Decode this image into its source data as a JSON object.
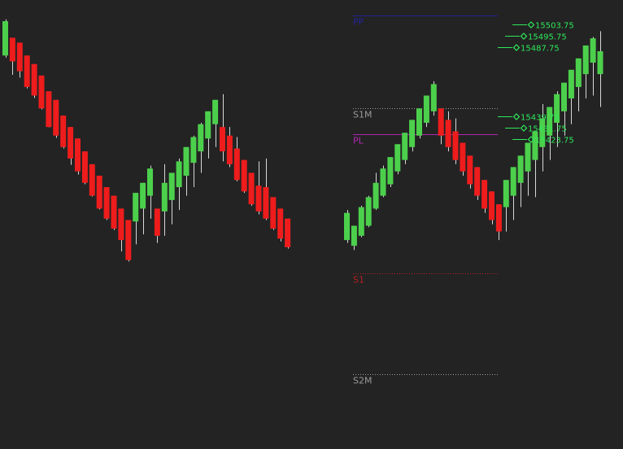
{
  "chart_data": {
    "type": "candlestick",
    "y_mapping": {
      "price_at_top": 15510,
      "price_per_px": 0.5686
    },
    "candles_first_side": [
      {
        "o": 15482.0,
        "c": 15506.0,
        "l": 15480.5,
        "h": 15507.3
      },
      {
        "o": 15494.4,
        "c": 15477.9,
        "l": 15468.5,
        "h": 15494.4
      },
      {
        "o": 15491.0,
        "c": 15471.0,
        "l": 15466.5,
        "h": 15491.0
      },
      {
        "o": 15482.0,
        "c": 15460.0,
        "l": 15459.0,
        "h": 15482.0
      },
      {
        "o": 15476.0,
        "c": 15454.0,
        "l": 15452.3,
        "h": 15476.0
      },
      {
        "o": 15468.0,
        "c": 15445.0,
        "l": 15444.3,
        "h": 15468.0
      },
      {
        "o": 15457.0,
        "c": 15432.0,
        "l": 15431.8,
        "h": 15457.0
      },
      {
        "o": 15451.0,
        "c": 15426.0,
        "l": 15424.4,
        "h": 15451.0
      },
      {
        "o": 15440.0,
        "c": 15418.0,
        "l": 15417.0,
        "h": 15440.0
      },
      {
        "o": 15432.0,
        "c": 15410.0,
        "l": 15405.6,
        "h": 15432.0
      },
      {
        "o": 15424.0,
        "c": 15401.0,
        "l": 15398.8,
        "h": 15424.0
      },
      {
        "o": 15415.0,
        "c": 15393.0,
        "l": 15392.0,
        "h": 15415.0
      },
      {
        "o": 15406.0,
        "c": 15384.0,
        "l": 15383.5,
        "h": 15406.0
      },
      {
        "o": 15398.0,
        "c": 15375.0,
        "l": 15374.4,
        "h": 15398.0
      },
      {
        "o": 15390.0,
        "c": 15368.0,
        "l": 15367.0,
        "h": 15390.0
      },
      {
        "o": 15384.0,
        "c": 15361.0,
        "l": 15360.0,
        "h": 15384.0
      },
      {
        "o": 15375.0,
        "c": 15353.0,
        "l": 15345.0,
        "h": 15375.0
      },
      {
        "o": 15367.0,
        "c": 15339.0,
        "l": 15338.0,
        "h": 15367.0
      },
      {
        "o": 15366.0,
        "c": 15386.0,
        "l": 15350.0,
        "h": 15386.0
      },
      {
        "o": 15375.0,
        "c": 15393.0,
        "l": 15357.0,
        "h": 15393.0
      },
      {
        "o": 15384.0,
        "c": 15403.0,
        "l": 15368.0,
        "h": 15405.0
      },
      {
        "o": 15375.0,
        "c": 15356.0,
        "l": 15351.0,
        "h": 15375.0
      },
      {
        "o": 15373.0,
        "c": 15393.0,
        "l": 15356.0,
        "h": 15406.0
      },
      {
        "o": 15381.0,
        "c": 15400.0,
        "l": 15364.0,
        "h": 15400.0
      },
      {
        "o": 15390.0,
        "c": 15408.0,
        "l": 15374.0,
        "h": 15410.0
      },
      {
        "o": 15398.0,
        "c": 15418.0,
        "l": 15384.0,
        "h": 15418.0
      },
      {
        "o": 15407.0,
        "c": 15425.0,
        "l": 15390.0,
        "h": 15426.0
      },
      {
        "o": 15415.0,
        "c": 15434.0,
        "l": 15400.0,
        "h": 15435.0
      },
      {
        "o": 15424.0,
        "c": 15443.0,
        "l": 15410.0,
        "h": 15443.0
      },
      {
        "o": 15434.0,
        "c": 15451.0,
        "l": 15418.0,
        "h": 15451.0
      },
      {
        "o": 15432.0,
        "c": 15415.0,
        "l": 15408.0,
        "h": 15455.0
      },
      {
        "o": 15426.0,
        "c": 15406.0,
        "l": 15404.0,
        "h": 15432.0
      },
      {
        "o": 15417.0,
        "c": 15395.0,
        "l": 15394.0,
        "h": 15425.0
      },
      {
        "o": 15409.0,
        "c": 15387.0,
        "l": 15386.0,
        "h": 15409.0
      },
      {
        "o": 15400.0,
        "c": 15378.0,
        "l": 15377.0,
        "h": 15400.0
      },
      {
        "o": 15391.0,
        "c": 15373.0,
        "l": 15371.0,
        "h": 15408.0
      },
      {
        "o": 15390.0,
        "c": 15368.0,
        "l": 15367.0,
        "h": 15410.0
      },
      {
        "o": 15383.0,
        "c": 15361.0,
        "l": 15360.0,
        "h": 15383.0
      },
      {
        "o": 15375.0,
        "c": 15354.0,
        "l": 15352.0,
        "h": 15375.0
      },
      {
        "o": 15368.0,
        "c": 15348.0,
        "l": 15347.0,
        "h": 15368.0
      }
    ],
    "candles_second_side": [
      {
        "o": 15353.0,
        "c": 15372.0,
        "l": 15351.0,
        "h": 15374.0
      },
      {
        "o": 15349.0,
        "c": 15363.0,
        "l": 15346.0,
        "h": 15363.0
      },
      {
        "o": 15356.0,
        "c": 15376.0,
        "l": 15355.0,
        "h": 15377.0
      },
      {
        "o": 15363.0,
        "c": 15383.0,
        "l": 15362.0,
        "h": 15384.0
      },
      {
        "o": 15375.0,
        "c": 15393.0,
        "l": 15374.0,
        "h": 15400.0
      },
      {
        "o": 15384.0,
        "c": 15403.0,
        "l": 15383.0,
        "h": 15405.0
      },
      {
        "o": 15392.0,
        "c": 15411.0,
        "l": 15390.0,
        "h": 15411.0
      },
      {
        "o": 15401.0,
        "c": 15420.0,
        "l": 15399.0,
        "h": 15420.0
      },
      {
        "o": 15409.0,
        "c": 15428.0,
        "l": 15406.0,
        "h": 15428.0
      },
      {
        "o": 15418.0,
        "c": 15437.0,
        "l": 15415.0,
        "h": 15437.0
      },
      {
        "o": 15426.0,
        "c": 15445.0,
        "l": 15424.0,
        "h": 15445.0
      },
      {
        "o": 15435.0,
        "c": 15454.0,
        "l": 15432.0,
        "h": 15454.0
      },
      {
        "o": 15443.0,
        "c": 15462.0,
        "l": 15440.0,
        "h": 15464.0
      },
      {
        "o": 15445.0,
        "c": 15426.0,
        "l": 15420.0,
        "h": 15445.0
      },
      {
        "o": 15437.0,
        "c": 15418.0,
        "l": 15415.0,
        "h": 15443.0
      },
      {
        "o": 15429.0,
        "c": 15409.0,
        "l": 15406.0,
        "h": 15438.0
      },
      {
        "o": 15421.0,
        "c": 15401.0,
        "l": 15398.0,
        "h": 15421.0
      },
      {
        "o": 15412.0,
        "c": 15392.0,
        "l": 15389.0,
        "h": 15412.0
      },
      {
        "o": 15404.0,
        "c": 15384.0,
        "l": 15381.0,
        "h": 15404.0
      },
      {
        "o": 15395.0,
        "c": 15375.0,
        "l": 15372.0,
        "h": 15395.0
      },
      {
        "o": 15387.0,
        "c": 15367.0,
        "l": 15364.0,
        "h": 15387.0
      },
      {
        "o": 15378.0,
        "c": 15359.0,
        "l": 15353.0,
        "h": 15378.0
      },
      {
        "o": 15376.0,
        "c": 15395.0,
        "l": 15359.0,
        "h": 15395.0
      },
      {
        "o": 15384.0,
        "c": 15404.0,
        "l": 15367.0,
        "h": 15404.0
      },
      {
        "o": 15393.0,
        "c": 15412.0,
        "l": 15376.0,
        "h": 15412.0
      },
      {
        "o": 15401.0,
        "c": 15421.0,
        "l": 15384.0,
        "h": 15421.0
      },
      {
        "o": 15409.0,
        "c": 15429.0,
        "l": 15383.0,
        "h": 15429.0
      },
      {
        "o": 15418.0,
        "c": 15438.0,
        "l": 15401.0,
        "h": 15448.0
      },
      {
        "o": 15426.0,
        "c": 15446.0,
        "l": 15409.0,
        "h": 15446.0
      },
      {
        "o": 15435.0,
        "c": 15455.0,
        "l": 15418.0,
        "h": 15457.0
      },
      {
        "o": 15443.0,
        "c": 15463.0,
        "l": 15426.0,
        "h": 15463.0
      },
      {
        "o": 15452.0,
        "c": 15472.0,
        "l": 15434.0,
        "h": 15472.0
      },
      {
        "o": 15460.0,
        "c": 15480.0,
        "l": 15443.0,
        "h": 15480.0
      },
      {
        "o": 15469.0,
        "c": 15489.0,
        "l": 15452.0,
        "h": 15489.0
      },
      {
        "o": 15477.0,
        "c": 15494.0,
        "l": 15454.0,
        "h": 15495.0
      },
      {
        "o": 15469.0,
        "c": 15485.0,
        "l": 15446.0,
        "h": 15499.0
      }
    ],
    "levels": [
      {
        "label": "PP",
        "price": 15510,
        "color": "#23239b",
        "style": "solid"
      },
      {
        "label": "S1M",
        "price": 15445,
        "color": "#9a9a9a",
        "style": "dotted"
      },
      {
        "label": "PL",
        "price": 15427,
        "color": "#b027b0",
        "style": "solid"
      },
      {
        "label": "S1",
        "price": 15330,
        "color": "#b32020",
        "style": "dotted"
      },
      {
        "label": "S2M",
        "price": 15259,
        "color": "#9a9a9a",
        "style": "dotted"
      }
    ],
    "targets": [
      {
        "label": "15503.75",
        "price": 15503.75
      },
      {
        "label": "15495.75",
        "price": 15495.75
      },
      {
        "label": "15487.75",
        "price": 15487.75
      },
      {
        "label": "15439.75",
        "price": 15439.75
      },
      {
        "label": "15431.75",
        "price": 15431.75
      },
      {
        "label": "15423.75",
        "price": 15423.75
      }
    ],
    "colors": {
      "up": "#4cd04c",
      "down": "#ee1c1c",
      "wick": "#d8d8d8",
      "target": "#2ee85a",
      "background": "#232323"
    }
  }
}
